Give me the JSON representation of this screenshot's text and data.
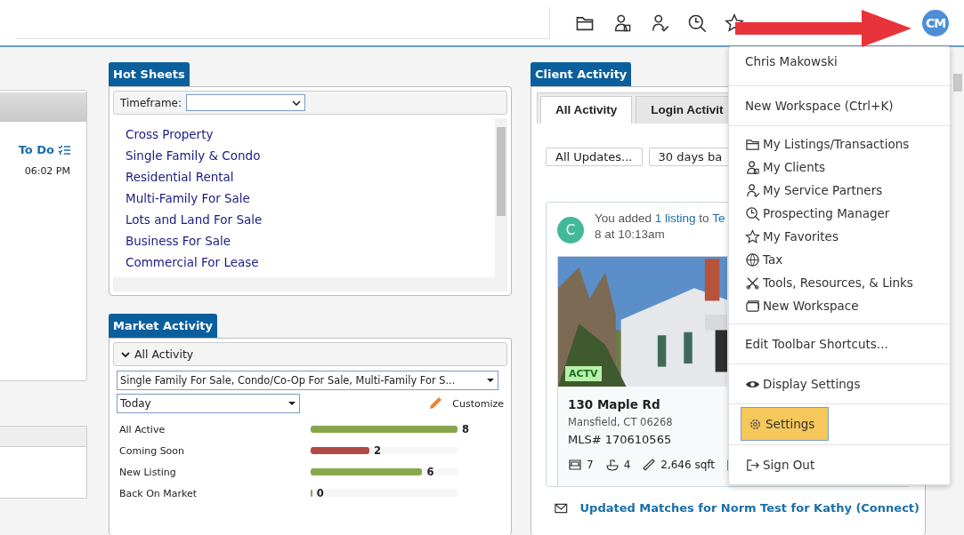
{
  "toolbar": {
    "avatar": "CM"
  },
  "left_panel": {
    "todo_label": "To Do",
    "time": "06:02 PM"
  },
  "hot_sheets": {
    "title": "Hot Sheets",
    "timeframe_label": "Timeframe:",
    "items": [
      "Cross Property",
      "Single Family & Condo",
      "Residential Rental",
      "Multi-Family For Sale",
      "Lots and Land For Sale",
      "Business For Sale",
      "Commercial For Lease"
    ]
  },
  "market_activity": {
    "title": "Market Activity",
    "section": "All Activity",
    "expanded": true,
    "type_select": "Single Family For Sale, Condo/Co-Op For Sale, Multi-Family For S...",
    "period_select": "Today",
    "customize": "Customize",
    "rows": [
      {
        "label": "All Active",
        "count": "8",
        "level": 1,
        "color": "#88a74d"
      },
      {
        "label": "Coming Soon",
        "count": "2",
        "level": 0.4,
        "color": "#b04a44"
      },
      {
        "label": "New Listing",
        "count": "6",
        "level": 0.76,
        "color": "#88a74d"
      },
      {
        "label": "Back On Market",
        "count": "0",
        "level": 0.01,
        "color": "#88a74d"
      }
    ]
  },
  "client_activity": {
    "title": "Client Activity",
    "tabs": [
      {
        "label": "All Activity",
        "selected": true
      },
      {
        "label": "Login Activit",
        "selected": false
      }
    ],
    "filters": [
      "All Updates...",
      "30 days ba"
    ],
    "feed": {
      "avatar": "C",
      "text_before": "You added ",
      "link": "1 listing",
      "text_after": " to ",
      "link2": "Te",
      "date": "8 at 10:13am",
      "listing": {
        "kind": "picture",
        "status": "ACTV",
        "address": "130 Maple Rd",
        "city": "Mansfield, CT 06268",
        "mls": "MLS# 170610565",
        "beds": "7",
        "baths": "4",
        "sqft": "2,646 sqft"
      }
    },
    "email_link": "Updated Matches for Norm Test for Kathy (Connect)"
  },
  "user_menu": {
    "sections": [
      {
        "items": [
          {
            "kind": "header",
            "label": "Chris Makowski",
            "selected": false
          }
        ]
      },
      {
        "items": [
          {
            "kind": "plain",
            "label": "New Workspace (Ctrl+K)",
            "selected": false
          }
        ]
      },
      {
        "items": [
          {
            "kind": "folder",
            "label": "My Listings/Transactions",
            "selected": false
          },
          {
            "kind": "clients",
            "label": "My Clients",
            "selected": false
          },
          {
            "kind": "partners",
            "label": "My Service Partners",
            "selected": false
          },
          {
            "kind": "prospecting",
            "label": "Prospecting Manager",
            "selected": false
          },
          {
            "kind": "favorites",
            "label": "My Favorites",
            "selected": false
          },
          {
            "kind": "tax",
            "label": "Tax",
            "selected": false
          },
          {
            "kind": "tools",
            "label": "Tools, Resources, & Links",
            "selected": false
          },
          {
            "kind": "workspace",
            "label": "New Workspace",
            "selected": false
          }
        ]
      },
      {
        "items": [
          {
            "kind": "plain",
            "label": "Edit Toolbar Shortcuts...",
            "selected": false
          }
        ]
      },
      {
        "items": [
          {
            "kind": "eye",
            "label": "Display Settings",
            "selected": false
          }
        ]
      },
      {
        "items": [
          {
            "kind": "gear",
            "label": "Settings",
            "selected": true
          }
        ]
      },
      {
        "items": [
          {
            "kind": "signout",
            "label": "Sign Out",
            "selected": false
          }
        ]
      }
    ]
  }
}
